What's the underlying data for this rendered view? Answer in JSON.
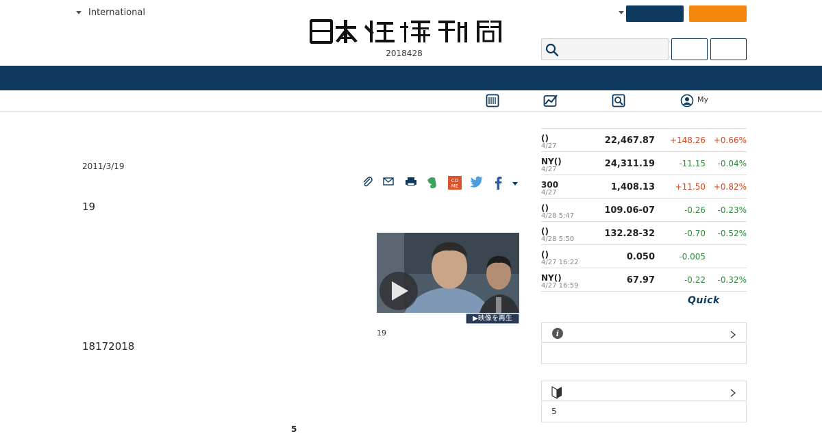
{
  "header": {
    "edition_label": "International",
    "logo_text": "日本経済新聞",
    "date": "2018428"
  },
  "subnav": {
    "my_label": "My"
  },
  "article": {
    "date": "2011/3/19",
    "lead": "19",
    "body_line": "18172018",
    "bottom_fragment": "5",
    "video_badge": "▶映像を再生",
    "video_caption": "19"
  },
  "market": {
    "rows": [
      {
        "name": "()",
        "time": "4/27",
        "value": "22,467.87",
        "change": "+148.26",
        "pct": "+0.66%",
        "dir": "up"
      },
      {
        "name": "NY()",
        "time": "4/27",
        "value": "24,311.19",
        "change": "-11.15",
        "pct": "-0.04%",
        "dir": "down"
      },
      {
        "name": "300",
        "time": "4/27",
        "value": "1,408.13",
        "change": "+11.50",
        "pct": "+0.82%",
        "dir": "up"
      },
      {
        "name": "()",
        "time": "4/28 5:47",
        "value": "109.06-07",
        "change": "-0.26",
        "pct": "-0.23%",
        "dir": "down"
      },
      {
        "name": "()",
        "time": "4/28 5:50",
        "value": "132.28-32",
        "change": "-0.70",
        "pct": "-0.52%",
        "dir": "down"
      },
      {
        "name": "()",
        "time": "4/27 16:22",
        "value": "0.050",
        "change": "-0.005",
        "pct": "",
        "dir": "down"
      },
      {
        "name": "NY()",
        "time": "4/27 16:59",
        "value": "67.97",
        "change": "-0.22",
        "pct": "-0.32%",
        "dir": "down"
      }
    ],
    "quick_logo": "Quick"
  },
  "sideboxes": {
    "info_body": "",
    "beginner_body": "5"
  },
  "icons": {
    "search": "search-icon",
    "paper": "newspaper-icon",
    "chart": "chart-icon",
    "zoom": "magnifier-icon",
    "user": "user-icon",
    "clip": "clip-icon",
    "mail": "mail-icon",
    "print": "print-icon",
    "evernote": "evernote-icon",
    "come": "come-icon",
    "twitter": "twitter-icon",
    "facebook": "facebook-icon",
    "info": "info-icon",
    "beginner": "beginner-icon"
  },
  "colors": {
    "brand_navy": "#0d3a5e",
    "brand_orange": "#f5890f",
    "up": "#d2461b",
    "down": "#2e8b3a"
  }
}
